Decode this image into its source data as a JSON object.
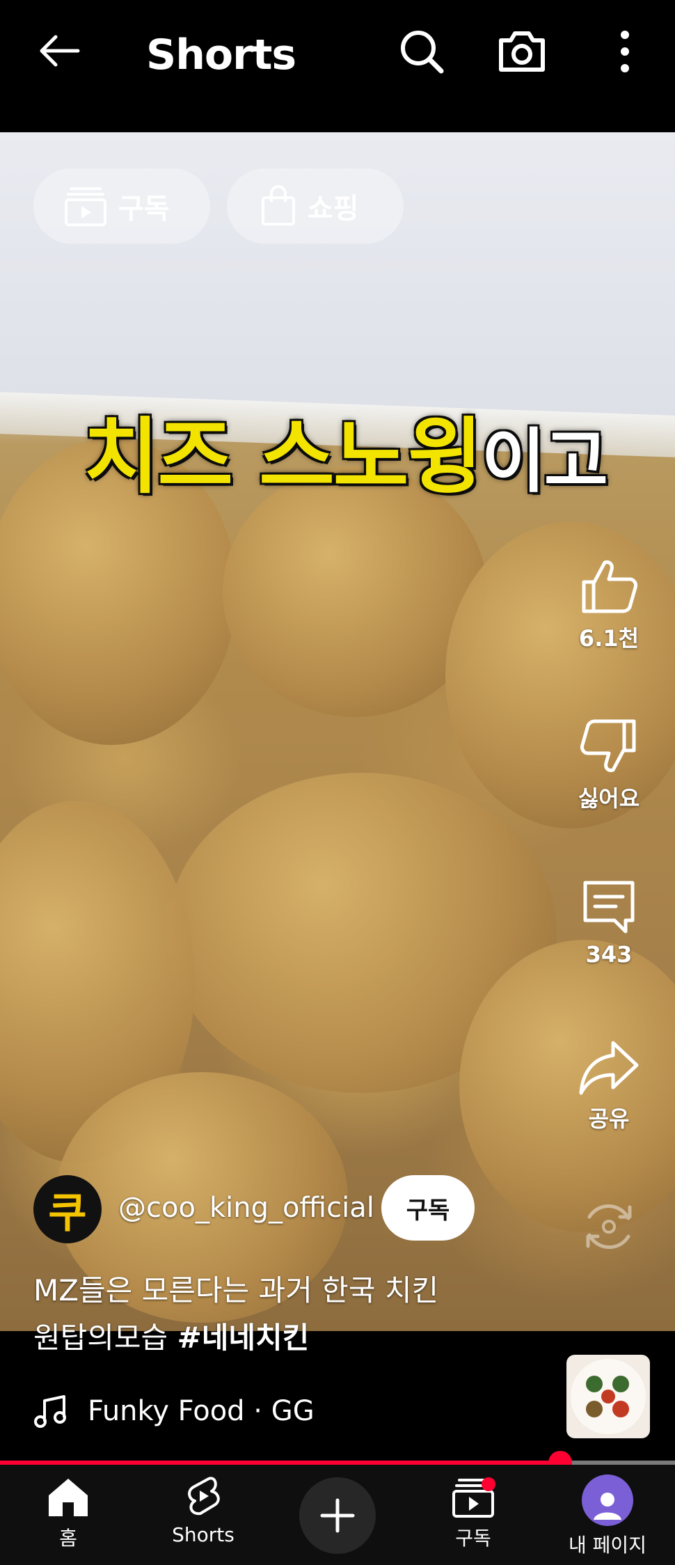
{
  "header": {
    "title": "Shorts"
  },
  "chips": {
    "subscriptions": "구독",
    "shopping": "쇼핑"
  },
  "caption": {
    "yellow": "치즈 스노윙",
    "white": "이고"
  },
  "actions": {
    "like_count": "6.1천",
    "dislike": "싫어요",
    "comments_count": "343",
    "share": "공유"
  },
  "channel": {
    "name": "@coo_king_official",
    "avatar_letter": "쿠",
    "subscribe_label": "구독"
  },
  "description": {
    "line1": "MZ들은 모른다는 과거 한국 치킨",
    "line2": "원탑의모습 ",
    "hashtag": "#네네치킨"
  },
  "music": {
    "text": "Funky Food · GG"
  },
  "progress": {
    "fraction": 0.83
  },
  "nav": {
    "home": "홈",
    "shorts": "Shorts",
    "subscriptions": "구독",
    "me": "내 페이지"
  },
  "colors": {
    "accent": "#ff0033",
    "caption_yellow": "#f3e400"
  }
}
